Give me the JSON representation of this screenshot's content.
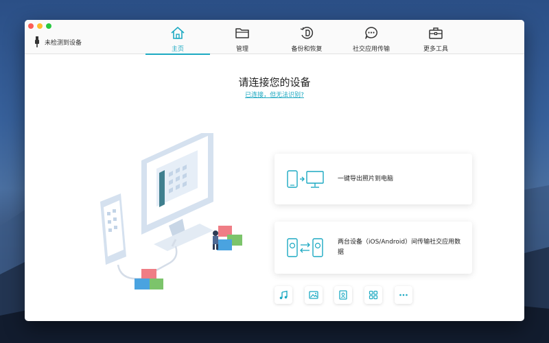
{
  "device": {
    "status": "未检测到设备",
    "icon": "usb-icon"
  },
  "nav": {
    "tabs": [
      {
        "label": "主页",
        "icon": "home-icon",
        "active": true
      },
      {
        "label": "管理",
        "icon": "folder-icon",
        "active": false
      },
      {
        "label": "备份和恢复",
        "icon": "backup-restore-icon",
        "active": false
      },
      {
        "label": "社交应用传输",
        "icon": "chat-bubble-icon",
        "active": false
      },
      {
        "label": "更多工具",
        "icon": "toolbox-icon",
        "active": false
      }
    ]
  },
  "main": {
    "heading": "请连接您的设备",
    "help_link": "已连接，但无法识别?",
    "cards": [
      {
        "text": "一键导出照片到电脑",
        "icon": "phone-to-computer-icon"
      },
      {
        "text": "两台设备（iOS/Android）间传输社交应用数据",
        "icon": "phone-to-phone-icon"
      }
    ],
    "tools": [
      {
        "icon": "music-icon"
      },
      {
        "icon": "photo-icon"
      },
      {
        "icon": "contacts-icon"
      },
      {
        "icon": "apps-icon"
      },
      {
        "icon": "more-icon"
      }
    ]
  },
  "colors": {
    "accent": "#1ba9c2",
    "link": "#1aa7c0",
    "text": "#222222"
  }
}
